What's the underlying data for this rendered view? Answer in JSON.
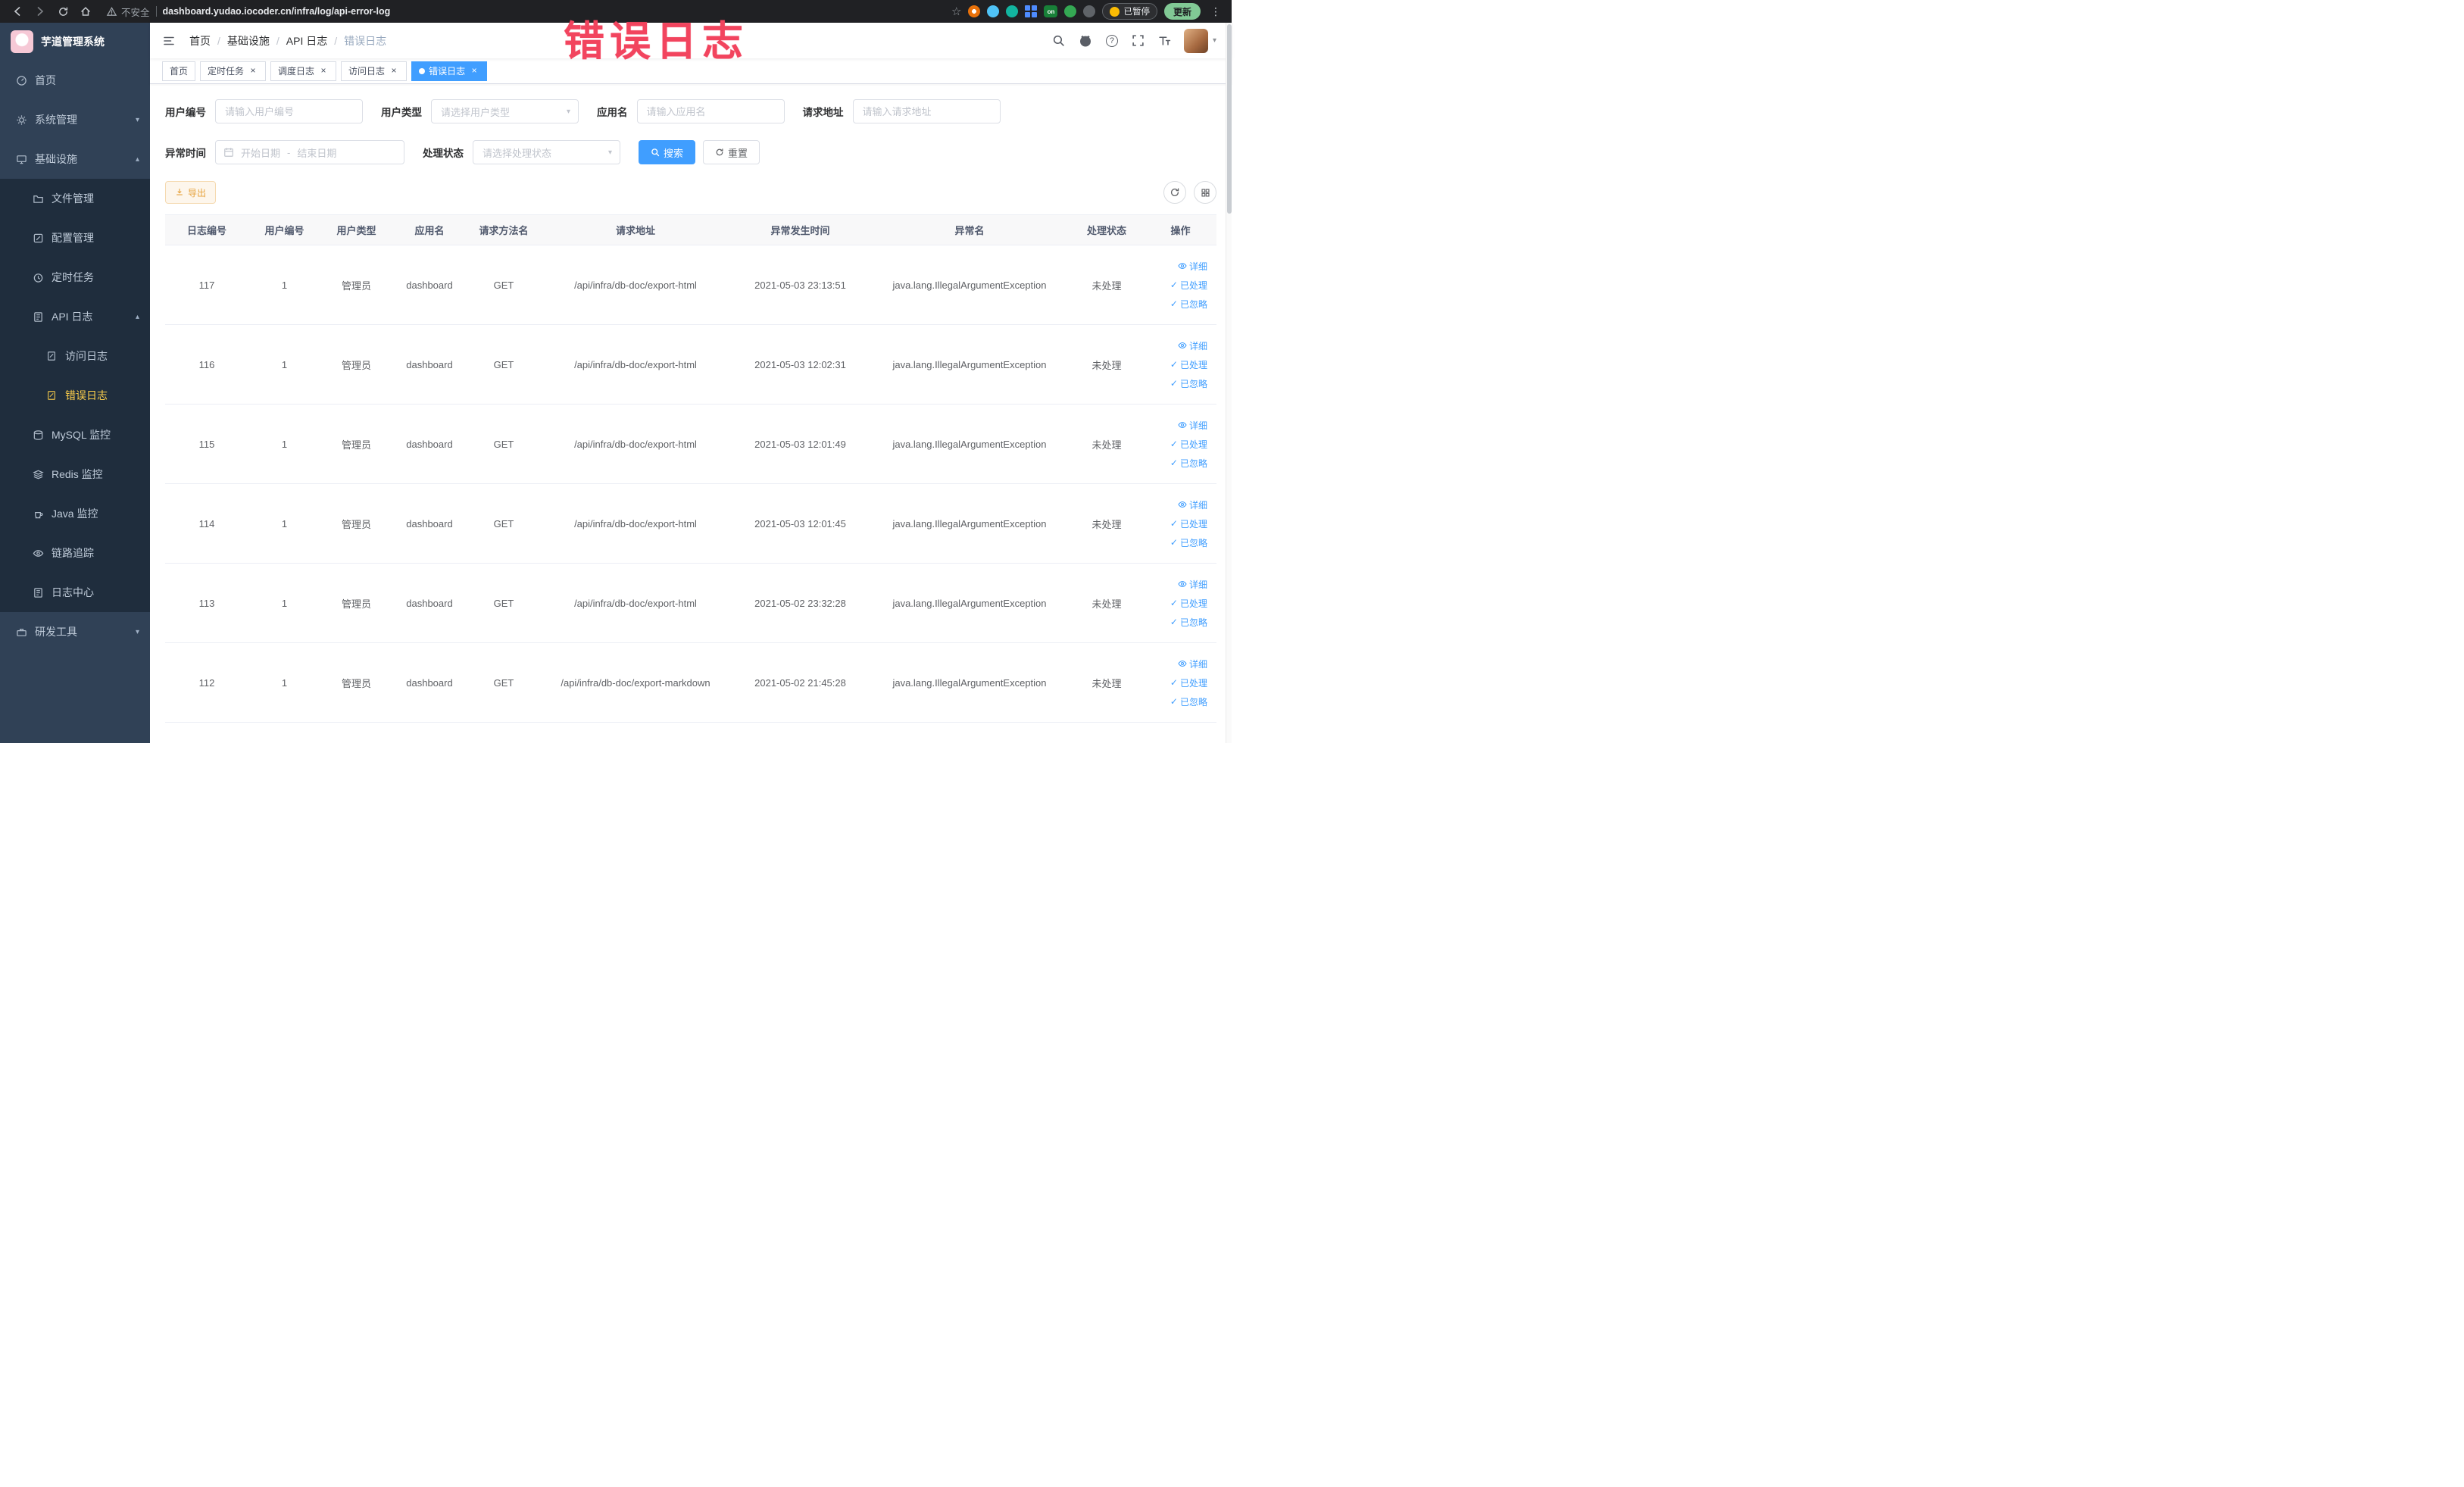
{
  "browser": {
    "security_label": "不安全",
    "url": "dashboard.yudao.iocoder.cn/infra/log/api-error-log",
    "extension_on_label": "on",
    "paused_badge": "已暂停",
    "update_button": "更新"
  },
  "annotation": {
    "text": "错误日志"
  },
  "icons": {
    "chevron_down": "▾",
    "chevron_up": "▴",
    "caret_down": "▾",
    "close": "×",
    "check": "✓",
    "star": "☆",
    "kebab": "⋮",
    "question": "?",
    "breadcrumb_separator": "/"
  },
  "sidebar": {
    "logo_title": "芋道管理系统",
    "items": [
      {
        "label": "首页"
      },
      {
        "label": "系统管理"
      },
      {
        "label": "基础设施"
      },
      {
        "label": "文件管理"
      },
      {
        "label": "配置管理"
      },
      {
        "label": "定时任务"
      },
      {
        "label": "API 日志"
      },
      {
        "label": "访问日志"
      },
      {
        "label": "错误日志"
      },
      {
        "label": "MySQL 监控"
      },
      {
        "label": "Redis 监控"
      },
      {
        "label": "Java 监控"
      },
      {
        "label": "链路追踪"
      },
      {
        "label": "日志中心"
      },
      {
        "label": "研发工具"
      }
    ]
  },
  "header": {
    "breadcrumb": [
      "首页",
      "基础设施",
      "API 日志",
      "错误日志"
    ]
  },
  "tabs": [
    {
      "label": "首页"
    },
    {
      "label": "定时任务"
    },
    {
      "label": "调度日志"
    },
    {
      "label": "访问日志"
    },
    {
      "label": "错误日志"
    }
  ],
  "filters": {
    "user_id": {
      "label": "用户编号",
      "placeholder": "请输入用户编号"
    },
    "user_type": {
      "label": "用户类型",
      "placeholder": "请选择用户类型"
    },
    "app_name": {
      "label": "应用名",
      "placeholder": "请输入应用名"
    },
    "request_url": {
      "label": "请求地址",
      "placeholder": "请输入请求地址"
    },
    "exception_time": {
      "label": "异常时间",
      "start_placeholder": "开始日期",
      "separator": "-",
      "end_placeholder": "结束日期"
    },
    "process_status": {
      "label": "处理状态",
      "placeholder": "请选择处理状态"
    },
    "search_button": "搜索",
    "reset_button": "重置"
  },
  "toolbar": {
    "export_button": "导出"
  },
  "table": {
    "headers": [
      "日志编号",
      "用户编号",
      "用户类型",
      "应用名",
      "请求方法名",
      "请求地址",
      "异常发生时间",
      "异常名",
      "处理状态",
      "操作"
    ],
    "actions": {
      "detail": "详细",
      "processed": "已处理",
      "ignored": "已忽略"
    },
    "rows": [
      {
        "id": "117",
        "user_id": "1",
        "user_type": "管理员",
        "app": "dashboard",
        "method": "GET",
        "url": "/api/infra/db-doc/export-html",
        "time": "2021-05-03 23:13:51",
        "exception": "java.lang.IllegalArgumentException",
        "status": "未处理"
      },
      {
        "id": "116",
        "user_id": "1",
        "user_type": "管理员",
        "app": "dashboard",
        "method": "GET",
        "url": "/api/infra/db-doc/export-html",
        "time": "2021-05-03 12:02:31",
        "exception": "java.lang.IllegalArgumentException",
        "status": "未处理"
      },
      {
        "id": "115",
        "user_id": "1",
        "user_type": "管理员",
        "app": "dashboard",
        "method": "GET",
        "url": "/api/infra/db-doc/export-html",
        "time": "2021-05-03 12:01:49",
        "exception": "java.lang.IllegalArgumentException",
        "status": "未处理"
      },
      {
        "id": "114",
        "user_id": "1",
        "user_type": "管理员",
        "app": "dashboard",
        "method": "GET",
        "url": "/api/infra/db-doc/export-html",
        "time": "2021-05-03 12:01:45",
        "exception": "java.lang.IllegalArgumentException",
        "status": "未处理"
      },
      {
        "id": "113",
        "user_id": "1",
        "user_type": "管理员",
        "app": "dashboard",
        "method": "GET",
        "url": "/api/infra/db-doc/export-html",
        "time": "2021-05-02 23:32:28",
        "exception": "java.lang.IllegalArgumentException",
        "status": "未处理"
      },
      {
        "id": "112",
        "user_id": "1",
        "user_type": "管理员",
        "app": "dashboard",
        "method": "GET",
        "url": "/api/infra/db-doc/export-markdown",
        "time": "2021-05-02 21:45:28",
        "exception": "java.lang.IllegalArgumentException",
        "status": "未处理"
      }
    ]
  }
}
